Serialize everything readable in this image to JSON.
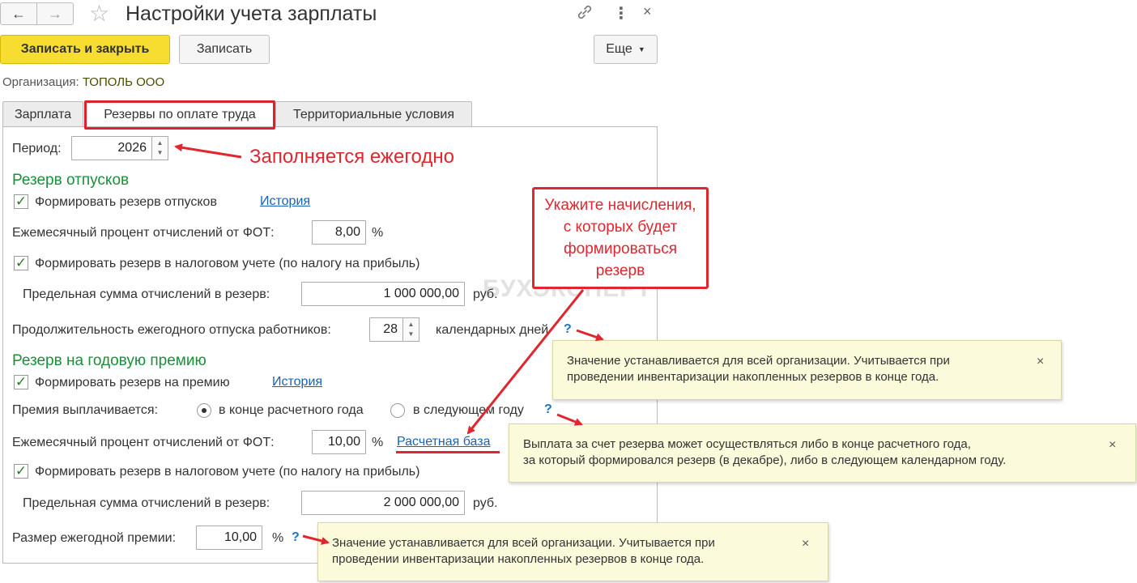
{
  "header": {
    "title": "Настройки учета зарплаты",
    "back_icon": "←",
    "forward_icon": "→",
    "star_icon": "☆",
    "link_icon": "🔗",
    "more_icon": "⋮",
    "close_icon": "×"
  },
  "toolbar": {
    "save_close_label": "Записать и закрыть",
    "save_label": "Записать",
    "more_label": "Еще"
  },
  "organization": {
    "label": "Организация:",
    "value": "ТОПОЛЬ ООО"
  },
  "tabs": [
    {
      "label": "Зарплата"
    },
    {
      "label": "Резервы по оплате труда"
    },
    {
      "label": "Территориальные условия"
    }
  ],
  "period": {
    "label": "Период:",
    "value": "2026"
  },
  "vacation_reserve": {
    "section_title": "Резерв отпусков",
    "form_label": "Формировать резерв отпусков",
    "history_link": "История",
    "monthly_percent_label": "Ежемесячный процент отчислений от ФОТ:",
    "monthly_percent_value": "8,00",
    "percent_unit": "%",
    "tax_label": "Формировать резерв в налоговом учете (по налогу на прибыль)",
    "limit_label": "Предельная сумма отчислений в резерв:",
    "limit_value": "1 000 000,00",
    "rub_unit": "руб.",
    "duration_label": "Продолжительность ежегодного отпуска работников:",
    "duration_value": "28",
    "duration_unit": "календарных дней",
    "help": "?"
  },
  "bonus_reserve": {
    "section_title": "Резерв на годовую премию",
    "form_label": "Формировать резерв на премию",
    "history_link": "История",
    "paid_label": "Премия выплачивается:",
    "option_end_year": "в конце расчетного года",
    "option_next_year": "в следующем году",
    "monthly_percent_label": "Ежемесячный процент отчислений от ФОТ:",
    "monthly_percent_value": "10,00",
    "percent_unit": "%",
    "base_link": "Расчетная база",
    "tax_label": "Формировать резерв в налоговом учете (по налогу на прибыль)",
    "limit_label": "Предельная сумма отчислений в резерв:",
    "limit_value": "2 000 000,00",
    "rub_unit": "руб.",
    "size_label": "Размер ежегодной премии:",
    "size_value": "10,00",
    "size_unit": "%",
    "help": "?"
  },
  "annotations": {
    "yearly": "Заполняется ежегодно",
    "callout_lines": [
      "Укажите начисления,",
      "с которых будет",
      "формироваться",
      "резерв"
    ],
    "watermark": "БУХЭКСПЕРТ"
  },
  "tooltips": {
    "vacation_line1": "Значение устанавливается для всей организации. Учитывается при",
    "vacation_line2": "проведении инвентаризации накопленных резервов в конце года.",
    "payout_line1": "Выплата за счет резерва может осуществляться либо в конце расчетного года,",
    "payout_line2": "за который формировался резерв (в декабре), либо в следующем календарном году.",
    "bonus_line1": "Значение устанавливается для всей организации. Учитывается при",
    "bonus_line2": "проведении инвентаризации накопленных резервов в конце года.",
    "close": "×"
  },
  "colors": {
    "primary_button": "#f7dd2f",
    "section_green": "#1a8f3a",
    "annotation_red": "#e0262f",
    "link_blue": "#1763b8",
    "tooltip_bg": "#fbfadb"
  }
}
